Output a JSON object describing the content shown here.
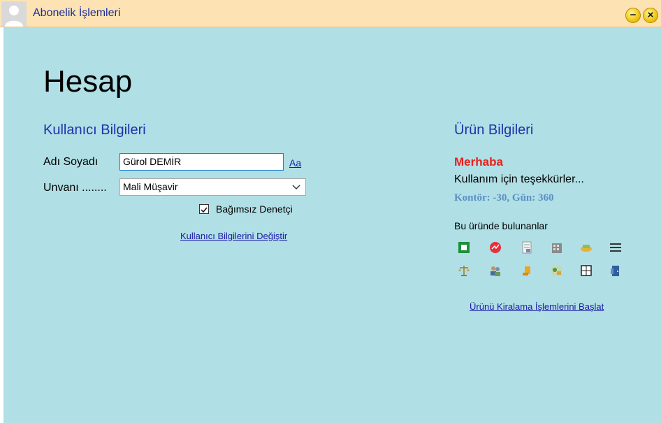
{
  "window": {
    "title": "Abonelik İşlemleri"
  },
  "page": {
    "heading": "Hesap"
  },
  "user_section": {
    "title": "Kullanıcı Bilgileri",
    "name_label": "Adı Soyadı",
    "name_value": "Gürol DEMİR",
    "font_link": "Aa",
    "title_label": "Unvanı ........",
    "title_value": "Mali Müşavir",
    "checkbox_label": "Bağımsız Denetçi",
    "checkbox_checked": true,
    "change_link": "Kullanıcı Bilgilerini Değiştir"
  },
  "product_section": {
    "title": "Ürün Bilgileri",
    "greeting": "Merhaba",
    "thanks": "Kullanım için teşekkürler...",
    "credit_line": "Kontör: -30, Gün: 360",
    "modules_label": "Bu üründe bulunanlar",
    "rental_link": "Ürünü Kiralama İşlemlerini Başlat",
    "module_icons": [
      "green-book-icon",
      "red-chart-icon",
      "paper-icon",
      "building-icon",
      "money-icon",
      "menu-lines-icon",
      "scales-icon",
      "users-icon",
      "coins-icon",
      "photo-icon",
      "calculator-icon",
      "door-icon"
    ]
  },
  "colors": {
    "titlebar_bg": "#fde3b4",
    "content_bg": "#b0dfe5",
    "section_title": "#1d33a8",
    "greeting": "#e8201c",
    "credit": "#5c8fc4"
  }
}
